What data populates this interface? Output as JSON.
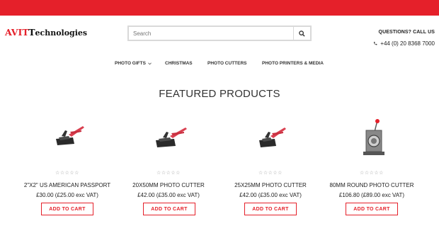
{
  "topbar": {
    "color": "#e5202a"
  },
  "logo": {
    "part1": "AVIT",
    "part2": "echnologies"
  },
  "search": {
    "placeholder": "Search",
    "icon": "search-icon"
  },
  "contact": {
    "question": "QUESTIONS? CALL US",
    "phone": "+44 (0) 20 8368 7000",
    "phone_icon": "phone-icon"
  },
  "nav": {
    "items": [
      {
        "label": "PHOTO GIFTS",
        "has_dropdown": true
      },
      {
        "label": "CHRISTMAS",
        "has_dropdown": false
      },
      {
        "label": "PHOTO CUTTERS",
        "has_dropdown": false
      },
      {
        "label": "PHOTO PRINTERS & MEDIA",
        "has_dropdown": false
      }
    ]
  },
  "featured": {
    "title": "FEATURED PRODUCTS"
  },
  "products": [
    {
      "name": "2\"X2\" US AMERICAN PASSPORT",
      "price": "£30.00 (£25.00 exc VAT)",
      "button": "ADD TO CART",
      "rating": 0
    },
    {
      "name": "20X50MM PHOTO CUTTER",
      "price": "£42.00 (£35.00 exc VAT)",
      "button": "ADD TO CART",
      "rating": 0
    },
    {
      "name": "25X25MM PHOTO CUTTER",
      "price": "£42.00 (£35.00 exc VAT)",
      "button": "ADD TO CART",
      "rating": 0
    },
    {
      "name": "80MM ROUND PHOTO CUTTER",
      "price": "£106.80 (£89.00 exc VAT)",
      "button": "ADD TO CART",
      "rating": 0
    }
  ],
  "colors": {
    "accent": "#e5202a"
  }
}
